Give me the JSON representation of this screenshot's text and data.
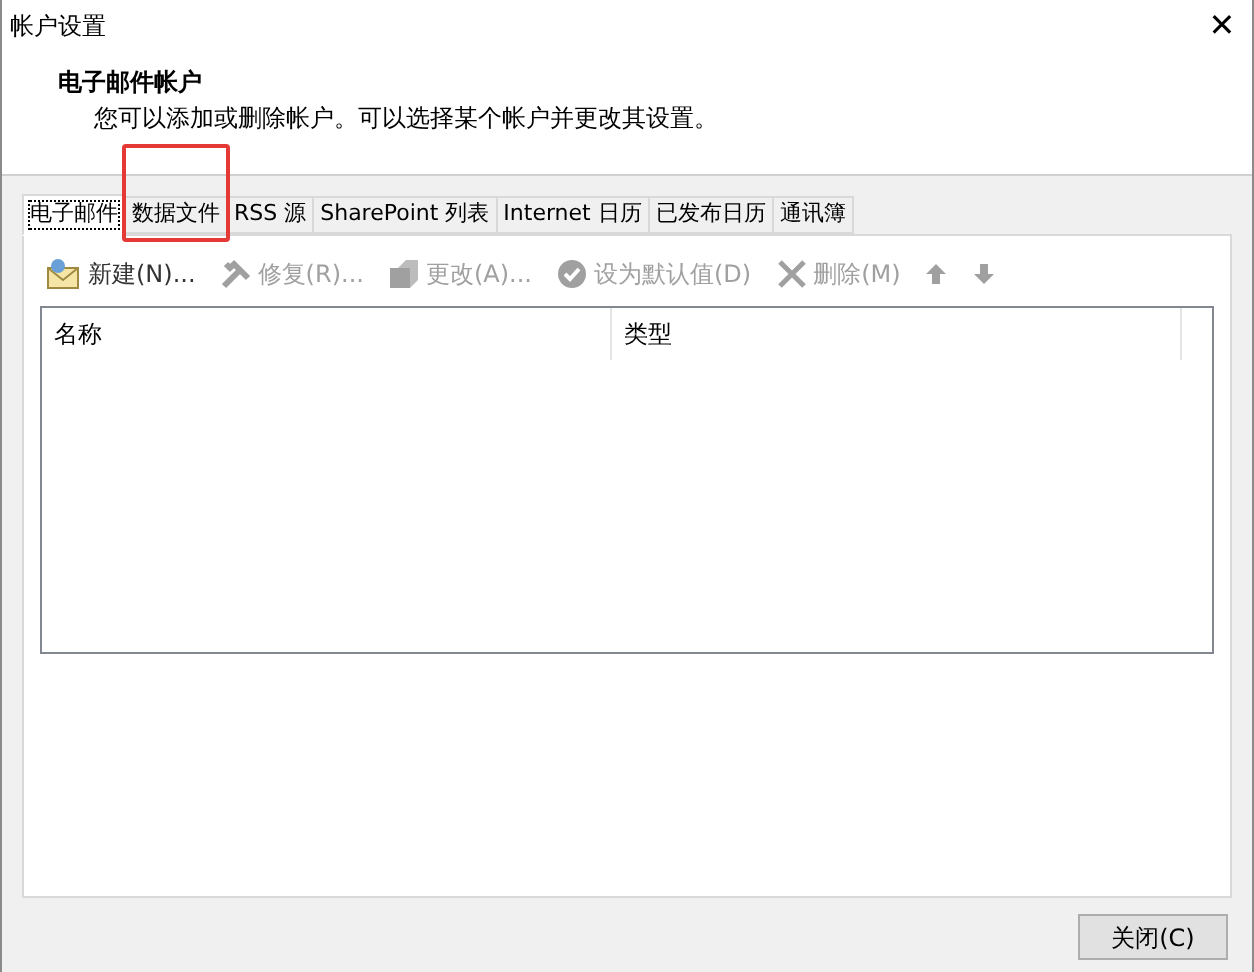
{
  "window": {
    "title": "帐户设置",
    "close": "✕"
  },
  "header": {
    "title": "电子邮件帐户",
    "description": "您可以添加或删除帐户。可以选择某个帐户并更改其设置。"
  },
  "tabs": [
    {
      "label": "电子邮件",
      "selected": true,
      "highlighted": false
    },
    {
      "label": "数据文件",
      "selected": false,
      "highlighted": true
    },
    {
      "label": "RSS 源",
      "selected": false,
      "highlighted": false
    },
    {
      "label": "SharePoint 列表",
      "selected": false,
      "highlighted": false
    },
    {
      "label": "Internet 日历",
      "selected": false,
      "highlighted": false
    },
    {
      "label": "已发布日历",
      "selected": false,
      "highlighted": false
    },
    {
      "label": "通讯簿",
      "selected": false,
      "highlighted": false
    }
  ],
  "toolbar": [
    {
      "kind": "new",
      "label": "新建(N)...",
      "disabled": false
    },
    {
      "kind": "repair",
      "label": "修复(R)...",
      "disabled": true
    },
    {
      "kind": "change",
      "label": "更改(A)...",
      "disabled": true
    },
    {
      "kind": "default",
      "label": "设为默认值(D)",
      "disabled": true
    },
    {
      "kind": "delete",
      "label": "删除(M)",
      "disabled": true
    },
    {
      "kind": "up",
      "disabled": true
    },
    {
      "kind": "down",
      "disabled": true
    }
  ],
  "table": {
    "columns": [
      "名称",
      "类型"
    ]
  },
  "buttons": [
    {
      "label": "关闭(C)"
    }
  ]
}
